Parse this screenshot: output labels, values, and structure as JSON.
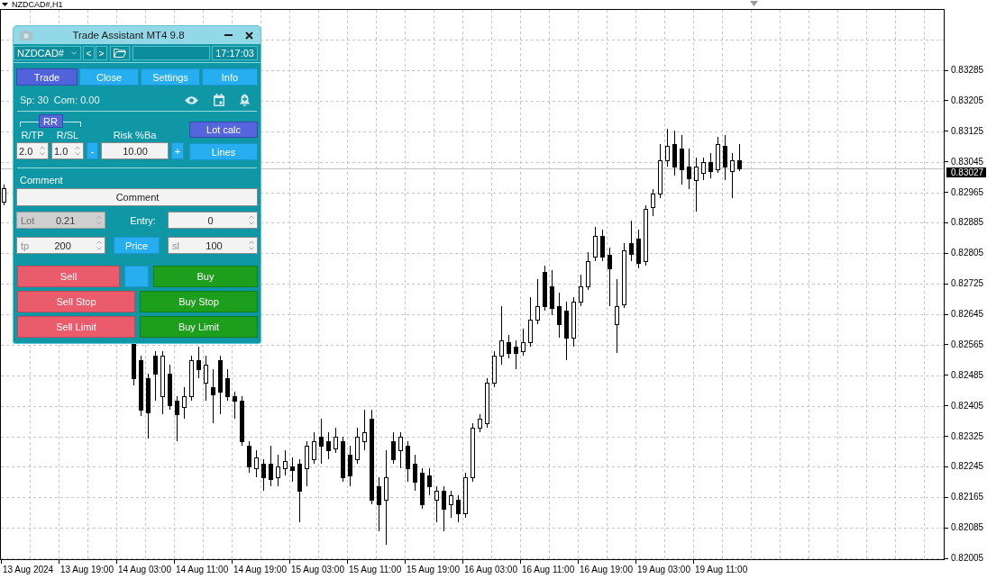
{
  "chart": {
    "title": "NZDCAD#,H1",
    "current_price": "0.83027",
    "price_axis": {
      "labels": [
        "0.83285",
        "0.83205",
        "0.83125",
        "0.83045",
        "0.82965",
        "0.82885",
        "0.82805",
        "0.82725",
        "0.82645",
        "0.82565",
        "0.82485",
        "0.82405",
        "0.82325",
        "0.82245",
        "0.82165",
        "0.82085",
        "0.82005"
      ]
    },
    "time_axis": {
      "labels": [
        "13 Aug 2024",
        "13 Aug 19:00",
        "14 Aug 03:00",
        "14 Aug 11:00",
        "14 Aug 19:00",
        "15 Aug 03:00",
        "15 Aug 11:00",
        "15 Aug 19:00",
        "16 Aug 03:00",
        "16 Aug 11:00",
        "16 Aug 19:00",
        "19 Aug 03:00",
        "19 Aug 11:00"
      ]
    }
  },
  "panel": {
    "title": "Trade Assistant MT4 9.8",
    "toolbar": {
      "symbol": "NZDCAD#",
      "prev": "<",
      "next": ">",
      "clock": "17:17:03"
    },
    "tabs": [
      {
        "label": "Trade",
        "selected": true
      },
      {
        "label": "Close",
        "selected": false
      },
      {
        "label": "Settings",
        "selected": false
      },
      {
        "label": "Info",
        "selected": false
      }
    ],
    "status": {
      "spread": "Sp: 30",
      "commission": "Com: 0.00"
    },
    "risk": {
      "rr_button": {
        "label": "RR",
        "on": true
      },
      "ratios": [
        {
          "label": "R/TP",
          "value": "2.0"
        },
        {
          "label": "R/SL",
          "value": "1.0"
        }
      ],
      "risk_label": "Risk %Ba",
      "minus": "-",
      "risk_value": "10.00",
      "plus": "+",
      "lot_calc": {
        "label": "Lot calc",
        "on": true
      },
      "lines": {
        "label": "Lines",
        "on": false
      }
    },
    "comment": {
      "label": "Comment",
      "value": "Comment"
    },
    "lot": {
      "label": "Lot",
      "value": "0.21",
      "disabled": true
    },
    "entry": {
      "label": "Entry:",
      "value": "0",
      "disabled": false
    },
    "tp": {
      "label": "tp",
      "value": "200",
      "disabled": false
    },
    "price_button": "Price",
    "sl": {
      "label": "sl",
      "value": "100",
      "disabled": false
    },
    "order_rows": [
      [
        {
          "kind": "sell",
          "label": "Sell"
        },
        {
          "kind": "blank"
        },
        {
          "kind": "buy",
          "label": "Buy"
        }
      ],
      [
        {
          "kind": "sell",
          "label": "Sell Stop"
        },
        {
          "kind": "buy",
          "label": "Buy Stop"
        }
      ],
      [
        {
          "kind": "sell",
          "label": "Sell Limit"
        },
        {
          "kind": "buy",
          "label": "Buy Limit"
        }
      ]
    ]
  }
}
